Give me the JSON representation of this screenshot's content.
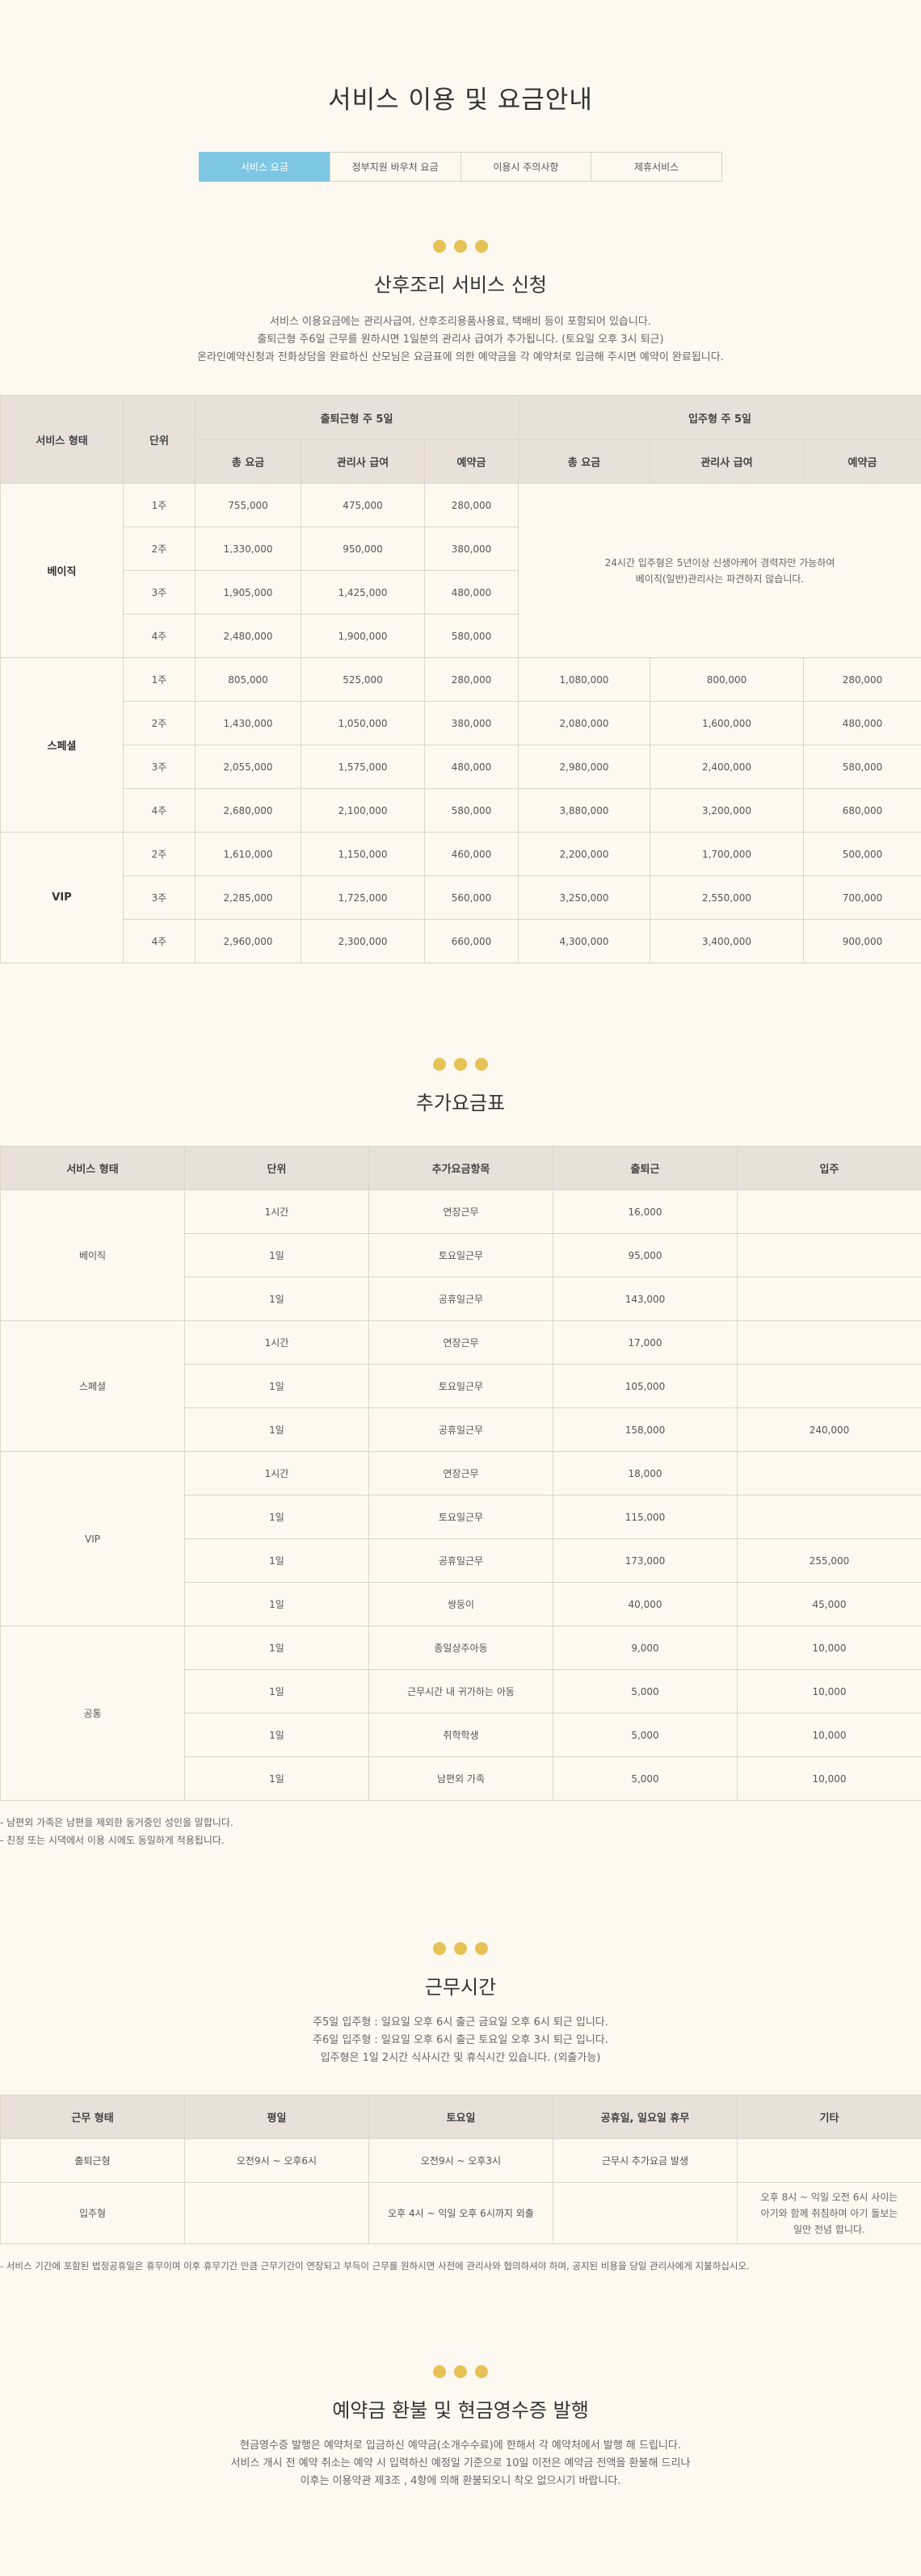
{
  "page_title": "서비스 이용 및 요금안내",
  "tabs": [
    {
      "label": "서비스 요금",
      "active": true
    },
    {
      "label": "정부지원 바우처 요금",
      "active": false
    },
    {
      "label": "이용시 주의사항",
      "active": false
    },
    {
      "label": "제휴서비스",
      "active": false
    }
  ],
  "colors": {
    "accent": "#7ec7e3",
    "dot": "#e6c256",
    "header_bg": "#e7e1d9",
    "page_bg": "#fdf9f1"
  },
  "apply": {
    "title": "산후조리 서비스 신청",
    "lines": [
      "서비스 이용요금에는 관리사급여, 산후조리용품사용료, 택배비 등이 포함되어 있습니다.",
      "출퇴근형 주6일 근무를 원하시면 1일분의 관리사 급여가 추가됩니다. (토요일 오후 3시 퇴근)",
      "온라인예약신청과 전화상담을 완료하신 산모님은 요금표에 의한 예약금을 각 예약처로 입금해 주시면 예약이 완료됩니다."
    ],
    "table": {
      "h_type": "서비스 형태",
      "h_unit": "단위",
      "h_commute": "출퇴근형 주 5일",
      "h_live": "입주형 주 5일",
      "h_total": "총 요금",
      "h_salary": "관리사 급여",
      "h_deposit": "예약금",
      "basic_note": "24시간 입주형은 5년이상 신생아케어 경력자만 가능하여\n베이직(일반)관리사는 파견하지 않습니다.",
      "groups": [
        {
          "name": "베이직",
          "rows": [
            [
              "1주",
              "755,000",
              "475,000",
              "280,000"
            ],
            [
              "2주",
              "1,330,000",
              "950,000",
              "380,000"
            ],
            [
              "3주",
              "1,905,000",
              "1,425,000",
              "480,000"
            ],
            [
              "4주",
              "2,480,000",
              "1,900,000",
              "580,000"
            ]
          ]
        },
        {
          "name": "스페셜",
          "rows": [
            [
              "1주",
              "805,000",
              "525,000",
              "280,000",
              "1,080,000",
              "800,000",
              "280,000"
            ],
            [
              "2주",
              "1,430,000",
              "1,050,000",
              "380,000",
              "2,080,000",
              "1,600,000",
              "480,000"
            ],
            [
              "3주",
              "2,055,000",
              "1,575,000",
              "480,000",
              "2,980,000",
              "2,400,000",
              "580,000"
            ],
            [
              "4주",
              "2,680,000",
              "2,100,000",
              "580,000",
              "3,880,000",
              "3,200,000",
              "680,000"
            ]
          ]
        },
        {
          "name": "VIP",
          "rows": [
            [
              "2주",
              "1,610,000",
              "1,150,000",
              "460,000",
              "2,200,000",
              "1,700,000",
              "500,000"
            ],
            [
              "3주",
              "2,285,000",
              "1,725,000",
              "560,000",
              "3,250,000",
              "2,550,000",
              "700,000"
            ],
            [
              "4주",
              "2,960,000",
              "2,300,000",
              "660,000",
              "4,300,000",
              "3,400,000",
              "900,000"
            ]
          ]
        }
      ]
    }
  },
  "extra": {
    "title": "추가요금표",
    "headers": [
      "서비스 형태",
      "단위",
      "추가요금항목",
      "출퇴근",
      "입주"
    ],
    "groups": [
      {
        "name": "베이직",
        "rows": [
          [
            "1시간",
            "연장근무",
            "16,000",
            ""
          ],
          [
            "1일",
            "토요일근무",
            "95,000",
            ""
          ],
          [
            "1일",
            "공휴일근무",
            "143,000",
            ""
          ]
        ]
      },
      {
        "name": "스페셜",
        "rows": [
          [
            "1시간",
            "연장근무",
            "17,000",
            ""
          ],
          [
            "1일",
            "토요일근무",
            "105,000",
            ""
          ],
          [
            "1일",
            "공휴일근무",
            "158,000",
            "240,000"
          ]
        ]
      },
      {
        "name": "VIP",
        "rows": [
          [
            "1시간",
            "연장근무",
            "18,000",
            ""
          ],
          [
            "1일",
            "토요일근무",
            "115,000",
            ""
          ],
          [
            "1일",
            "공휴일근무",
            "173,000",
            "255,000"
          ],
          [
            "1일",
            "쌍둥이",
            "40,000",
            "45,000"
          ]
        ]
      },
      {
        "name": "공통",
        "rows": [
          [
            "1일",
            "종일상주아동",
            "9,000",
            "10,000"
          ],
          [
            "1일",
            "근무시간 내 귀가하는 아동",
            "5,000",
            "10,000"
          ],
          [
            "1일",
            "취학학생",
            "5,000",
            "10,000"
          ],
          [
            "1일",
            "남편외 가족",
            "5,000",
            "10,000"
          ]
        ]
      }
    ],
    "notes": [
      "- 남편외 가족은 남편을 제외한 동거중인 성인을 말합니다.",
      "- 친정 또는 시댁에서 이용 시에도 동일하게 적용됩니다."
    ]
  },
  "hours": {
    "title": "근무시간",
    "lines": [
      "주5일 입주형 : 일요일 오후 6시 출근 금요일 오후 6시 퇴근 입니다.",
      "주6일 입주형 : 일요일 오후 6시 출근 토요일 오후 3시 퇴근 입니다.",
      "입주형은 1일 2시간 식사시간 및 휴식시간 있습니다. (외출가능)"
    ],
    "headers": [
      "근무 형태",
      "평일",
      "토요일",
      "공휴일, 일요일 휴무",
      "기타"
    ],
    "rows": [
      [
        "출퇴근형",
        "오전9시 ~ 오후6시",
        "오전9시 ~ 오후3시",
        "근무시 추가요금 발생",
        ""
      ],
      [
        "입주형",
        "",
        "오후 4시 ~ 익일 오후 6시까지 외출",
        "",
        "오후 8시 ~ 익일 오전 6시 사이는\n아기와 함께 취침하며 아기 돌보는\n일만 전념 합니다."
      ]
    ],
    "note": "- 서비스 기간에 포함된 법정공휴일은 휴무이며 이후 휴무기간 만큼 근무기간이 연장되고 부득이 근무를 원하시면 사전에 관리사와 협의하셔야 하며, 공지된 비용을 당일 관리사에게 지불하십시오."
  },
  "refund": {
    "title": "예약금 환불 및 현금영수증 발행",
    "lines": [
      "현금영수증 발행은 예약처로 입금하신 예약금(소개수수료)에 한해서 각 예약처에서 발행 해 드립니다.",
      "서비스 개시 전 예약 취소는 예약 시 입력하신 예정일 기준으로 10일 이전은 예약금 전액을 환불해 드리나",
      "이후는 이용약관 제3조 , 4항에 의해 환불되오니 착오 없으시기 바랍니다."
    ]
  }
}
